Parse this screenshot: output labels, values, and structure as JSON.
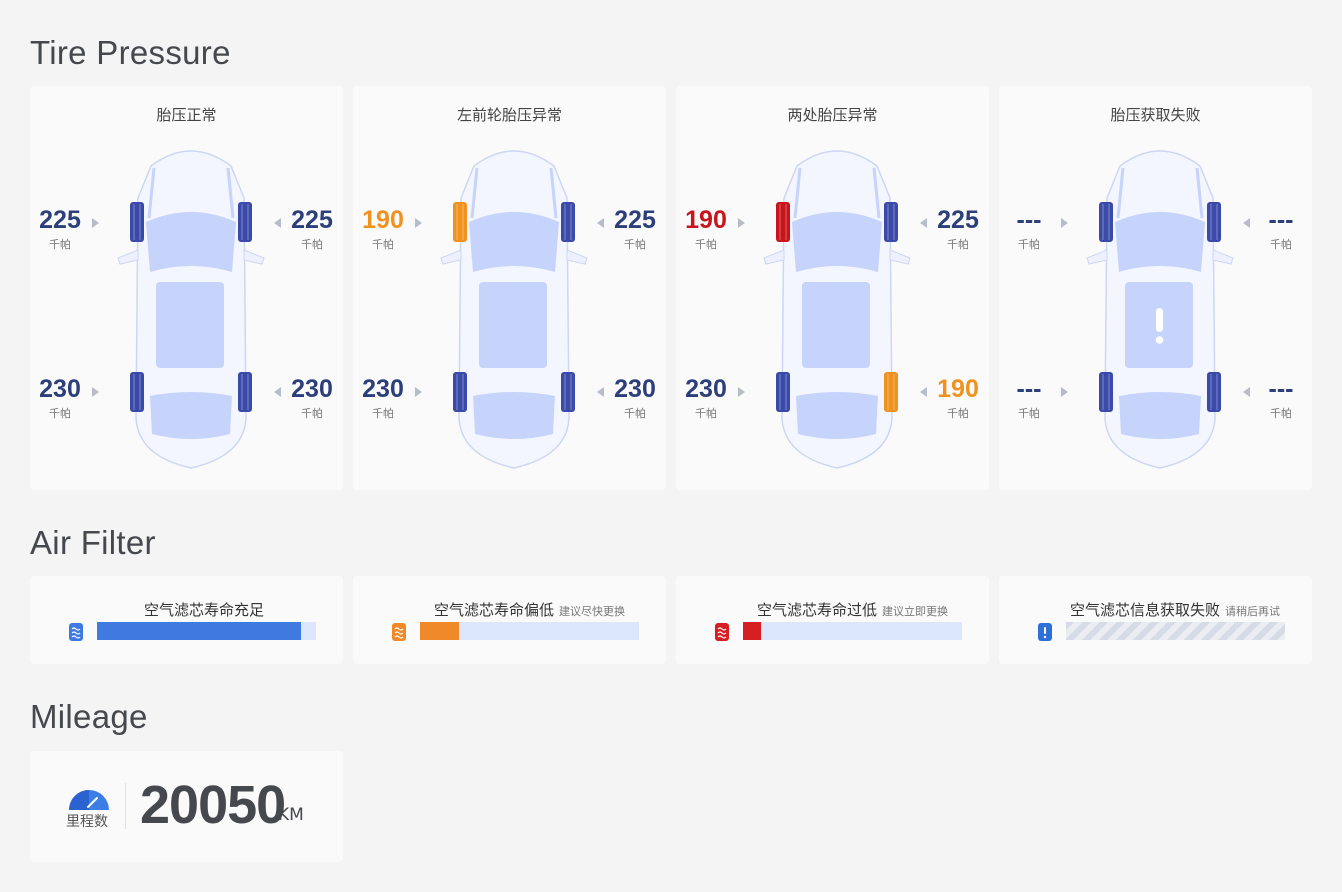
{
  "sections": {
    "tire_pressure": "Tire Pressure",
    "air_filter": "Air Filter",
    "mileage": "Mileage"
  },
  "unit": "千帕",
  "tire_cards": [
    {
      "title": "胎压正常",
      "front_left": "225",
      "front_right": "225",
      "rear_left": "230",
      "rear_right": "230",
      "tire_colors": {
        "front_left": "normal",
        "front_right": "normal",
        "rear_left": "normal",
        "rear_right": "normal"
      }
    },
    {
      "title": "左前轮胎压异常",
      "front_left": "190",
      "front_right": "225",
      "rear_left": "230",
      "rear_right": "230",
      "tire_colors": {
        "front_left": "warn",
        "front_right": "normal",
        "rear_left": "normal",
        "rear_right": "normal"
      }
    },
    {
      "title": "两处胎压异常",
      "front_left": "190",
      "front_right": "225",
      "rear_left": "230",
      "rear_right": "190",
      "tire_colors": {
        "front_left": "danger",
        "front_right": "normal",
        "rear_left": "normal",
        "rear_right": "warn"
      }
    },
    {
      "title": "胎压获取失败",
      "front_left": "---",
      "front_right": "---",
      "rear_left": "---",
      "rear_right": "---",
      "tire_colors": {
        "front_left": "normal",
        "front_right": "normal",
        "rear_left": "normal",
        "rear_right": "normal"
      },
      "alert_icon": "exclamation-icon"
    }
  ],
  "air_filters": [
    {
      "title": "空气滤芯寿命充足",
      "sub": "",
      "level": 0.93,
      "color": "#3f7ae0",
      "icon": "filter-blue-icon"
    },
    {
      "title": "空气滤芯寿命偏低",
      "sub": "建议尽快更换",
      "level": 0.18,
      "color": "#f0892a",
      "icon": "filter-orange-icon"
    },
    {
      "title": "空气滤芯寿命过低",
      "sub": "建议立即更换",
      "level": 0.08,
      "color": "#d61f23",
      "icon": "filter-red-icon"
    },
    {
      "title": "空气滤芯信息获取失败",
      "sub": "请稍后再试",
      "level": null,
      "color": "#2f6fd8",
      "icon": "filter-alert-icon"
    }
  ],
  "mileage": {
    "label": "里程数",
    "value": "20050",
    "unit": "KM"
  },
  "colors": {
    "normal_tire": "#3b4aa8",
    "warn": "#f0921f",
    "danger": "#c8141b",
    "value_text": "#2c3f7a"
  }
}
